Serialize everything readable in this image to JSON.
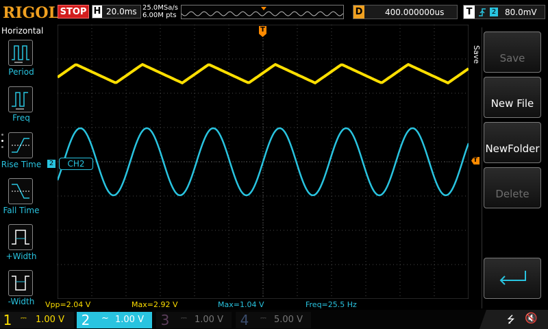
{
  "brand": "RIGOL",
  "run_state": "STOP",
  "horizontal": {
    "letter": "H",
    "timebase": "20.0ms",
    "sample_rate": "25.0MSa/s",
    "memory": "6.00M pts"
  },
  "delay": {
    "letter": "D",
    "value": "400.000000us"
  },
  "trigger": {
    "letter": "T",
    "channel": "2",
    "level": "80.0mV"
  },
  "left_menu": {
    "title": "Horizontal",
    "items": [
      {
        "label": "Period",
        "icon": "period-icon"
      },
      {
        "label": "Freq",
        "icon": "frequency-icon"
      },
      {
        "label": "Rise Time",
        "icon": "rise-time-icon"
      },
      {
        "label": "Fall Time",
        "icon": "fall-time-icon"
      },
      {
        "label": "+Width",
        "icon": "positive-width-icon"
      },
      {
        "label": "-Width",
        "icon": "negative-width-icon"
      }
    ]
  },
  "right_menu": {
    "title": "Save",
    "items": [
      {
        "label": "Save",
        "enabled": false
      },
      {
        "label": "New File",
        "enabled": true
      },
      {
        "label": "NewFolder",
        "enabled": true
      },
      {
        "label": "Delete",
        "enabled": false
      }
    ],
    "enter_icon": "enter-arrow-icon"
  },
  "ch2_marker": {
    "number": "2",
    "label": "CH2"
  },
  "measurements": {
    "vpp": "Vpp=2.04 V",
    "max1": "Max=2.92 V",
    "max2": "Max=1.04 V",
    "freq": "Freq=25.5 Hz"
  },
  "channels": [
    {
      "num": "1",
      "coupling": "DC",
      "scale": "1.00 V",
      "color": "#ffdf00",
      "active": true
    },
    {
      "num": "2",
      "coupling": "AC",
      "scale": "1.00 V",
      "color": "#29c4e0",
      "active": true
    },
    {
      "num": "3",
      "coupling": "DC",
      "scale": "1.00 V",
      "color": "#e040c0",
      "active": false
    },
    {
      "num": "4",
      "coupling": "DC",
      "scale": "5.00 V",
      "color": "#2e6fe0",
      "active": false
    }
  ],
  "status_icons": [
    "usb-icon",
    "speaker-muted-icon"
  ],
  "colors": {
    "ch1": "#ffdf00",
    "ch2": "#29c4e0",
    "trigger": "#ff8a00",
    "stop": "#d21e1e"
  }
}
